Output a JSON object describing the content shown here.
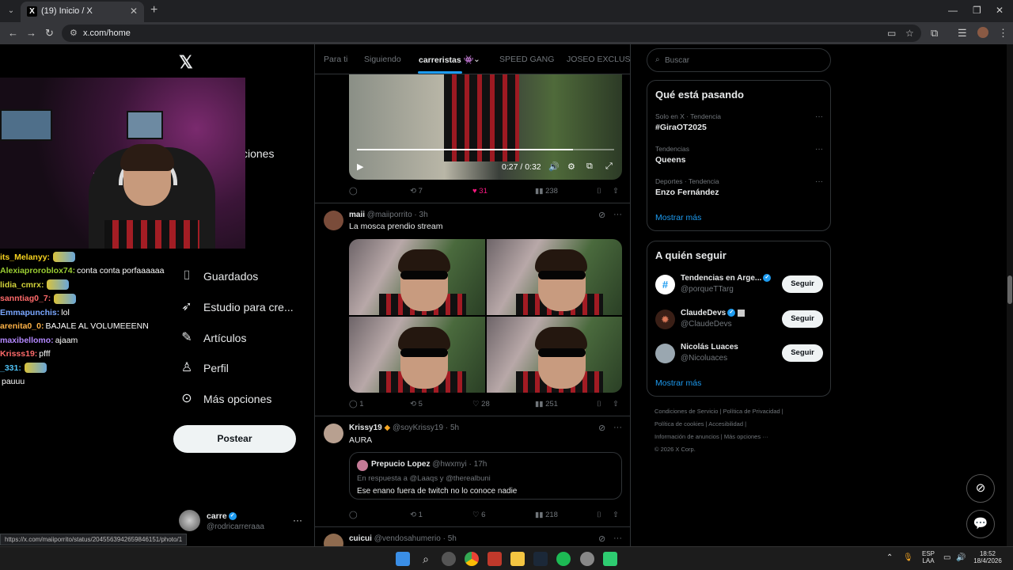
{
  "browser": {
    "tab_title": "(19) Inicio / X",
    "tab_favicon": "X",
    "url": "x.com/home",
    "status_url": "https://x.com/maiiporrito/status/2045563942659846151/photo/1"
  },
  "stream_chat": [
    {
      "user": "its_Melanyy:",
      "color": "#f6d21f",
      "msg": "",
      "emote": true
    },
    {
      "user": "Alexiaproroblox74:",
      "color": "#9acd32",
      "msg": "conta conta porfaaaaaa",
      "emote": false
    },
    {
      "user": "lidia_cmrx:",
      "color": "#d2d23a",
      "msg": "",
      "emote": true
    },
    {
      "user": "sanntiag0_7:",
      "color": "#ff6a6a",
      "msg": "",
      "emote": true
    },
    {
      "user": "Emmapunchis:",
      "color": "#7aa7ff",
      "msg": "lol",
      "emote": false
    },
    {
      "user": "arenita0_0:",
      "color": "#ffb347",
      "msg": "BAJALE AL VOLUMEEENN",
      "emote": false
    },
    {
      "user": "maxibellomo:",
      "color": "#b388ff",
      "msg": "ajaam",
      "emote": false
    },
    {
      "user": "Krisss19:",
      "color": "#ff6a6a",
      "msg": "pfff",
      "emote": false
    },
    {
      "user": "_331:",
      "color": "#4fc3f7",
      "msg": "",
      "emote": true
    },
    {
      "user": "",
      "color": "#ffffff",
      "msg": "pauuu",
      "emote": false
    }
  ],
  "sidebar": {
    "partial_label": "ciones",
    "items": [
      {
        "label": "Guardados",
        "icon": "bookmark-icon",
        "glyph": "⌷"
      },
      {
        "label": "Estudio para cre...",
        "icon": "rocket-icon",
        "glyph": "➶"
      },
      {
        "label": "Artículos",
        "icon": "article-icon",
        "glyph": "✎"
      },
      {
        "label": "Perfil",
        "icon": "person-icon",
        "glyph": "♙"
      },
      {
        "label": "Más opciones",
        "icon": "more-circle-icon",
        "glyph": "⊙"
      }
    ],
    "post_label": "Postear",
    "account": {
      "name": "carre",
      "handle": "@rodricarreraaa"
    }
  },
  "timeline": {
    "tabs": [
      "Para ti",
      "Siguiendo",
      "carreristas 👾",
      "SPEED GANG",
      "JOSEO EXCLUSIV"
    ],
    "active_tab": "carreristas 👾",
    "video": {
      "time": "0:27 / 0:32",
      "progress": 0.84
    },
    "tweet0_actions": {
      "replies": "",
      "reposts": "7",
      "likes": "31",
      "views": "238"
    },
    "tweets": [
      {
        "name": "maii",
        "handle": "@maiiporrito",
        "time": "3h",
        "text": "La mosca prendio stream",
        "actions": {
          "replies": "1",
          "reposts": "5",
          "likes": "28",
          "views": "251"
        }
      },
      {
        "name": "Krissy19",
        "handle": "@soyKrissy19",
        "time": "5h",
        "text": "AURA",
        "quote": {
          "name": "Prepucio Lopez",
          "handle": "@hwxmyi",
          "time": "17h",
          "reply_to": "En respuesta a @Laaqs y @therealbuni",
          "text": "Ese enano fuera de twitch no lo conoce nadie"
        },
        "actions": {
          "replies": "",
          "reposts": "1",
          "likes": "6",
          "views": "218"
        }
      },
      {
        "name": "cuicui",
        "handle": "@vendosahumerio",
        "time": "5h"
      }
    ]
  },
  "right": {
    "search_placeholder": "Buscar",
    "trends_title": "Qué está pasando",
    "trends": [
      {
        "meta": "Solo en X · Tendencia",
        "name": "#GiraOT2025"
      },
      {
        "meta": "Tendencias",
        "name": "Queens"
      },
      {
        "meta": "Deportes · Tendencia",
        "name": "Enzo Fernández"
      }
    ],
    "show_more": "Mostrar más",
    "follow_title": "A quién seguir",
    "follow": [
      {
        "name": "Tendencias en Arge...",
        "handle": "@porqueTTarg",
        "btn": "Seguir",
        "color": "#1d9bf0"
      },
      {
        "name": "ClaudeDevs",
        "handle": "@ClaudeDevs",
        "btn": "Seguir",
        "color": "#d97757"
      },
      {
        "name": "Nicolás Luaces",
        "handle": "@Nicoluaces",
        "btn": "Seguir",
        "color": "#9aa7b0"
      }
    ],
    "footer": [
      "Condiciones de Servicio  |  Política de Privacidad  |",
      "Política de cookies  |  Accesibilidad  |",
      "Información de anuncios  |  Más opciones ···",
      "© 2026 X Corp."
    ]
  },
  "taskbar": {
    "lang": "ESP",
    "lang2": "LAA",
    "time": "18:52",
    "date": "18/4/2026"
  }
}
